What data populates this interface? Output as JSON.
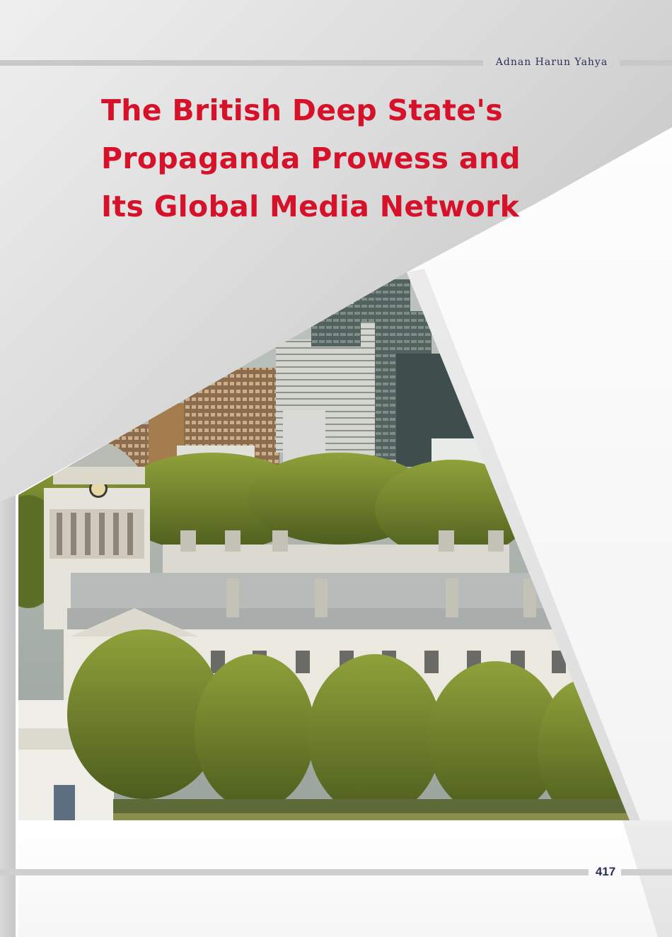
{
  "header": {
    "author": "Adnan Harun Yahya"
  },
  "article": {
    "title_lines": [
      "The British Deep State's",
      "Propaganda Prowess and",
      "Its Global Media Network"
    ]
  },
  "footer": {
    "page_number": "417"
  },
  "colors": {
    "title": "#d6122b",
    "author": "#2b2f55",
    "rules": "#c8c8c8"
  },
  "illustration": {
    "subject": "Greenwich skyline with Canary Wharf towers, trees and classical domed building"
  }
}
